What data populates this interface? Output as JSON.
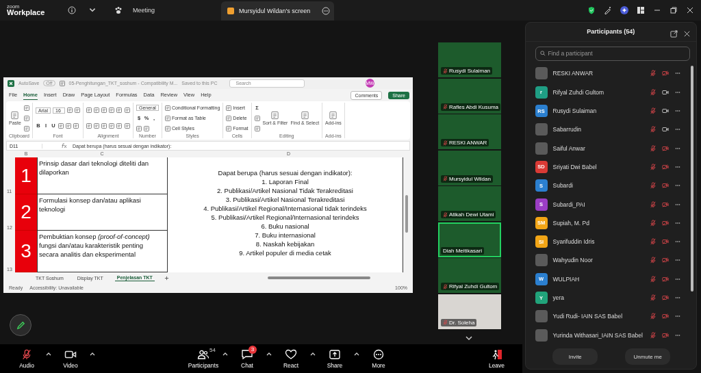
{
  "app_bar": {
    "logo_top": "zoom",
    "logo_bottom": "Workplace",
    "meeting_tab": "Meeting",
    "share_tab": "Mursyidul Wildan's screen"
  },
  "excel": {
    "title_bar": {
      "autosave": "AutoSave",
      "autosave_state": "Off",
      "filename": "05-Penghitungan_TKT_soshum - Compatibility M...",
      "saved": "Saved to this PC",
      "search": "Search",
      "user_initials": "MW"
    },
    "menu_tabs": [
      {
        "label": "File",
        "selected": false
      },
      {
        "label": "Home",
        "selected": true
      },
      {
        "label": "Insert",
        "selected": false
      },
      {
        "label": "Draw",
        "selected": false
      },
      {
        "label": "Page Layout",
        "selected": false
      },
      {
        "label": "Formulas",
        "selected": false
      },
      {
        "label": "Data",
        "selected": false
      },
      {
        "label": "Review",
        "selected": false
      },
      {
        "label": "View",
        "selected": false
      },
      {
        "label": "Help",
        "selected": false
      }
    ],
    "comments": "Comments",
    "share": "Share",
    "ribbon_groups": [
      {
        "label": "Clipboard",
        "parts": [
          {
            "kind": "big",
            "label": "Paste"
          },
          {
            "kind": "stack",
            "lines": [
              [
                {
                  "kind": "glyph"
                }
              ],
              [
                {
                  "kind": "glyph"
                }
              ],
              [
                {
                  "kind": "glyph"
                }
              ]
            ]
          }
        ]
      },
      {
        "label": "Font",
        "parts": [
          {
            "kind": "stack",
            "lines": [
              [
                {
                  "kind": "field",
                  "label": "Arial"
                },
                {
                  "kind": "field",
                  "label": "16"
                },
                {
                  "kind": "glyph"
                },
                {
                  "kind": "glyph"
                }
              ],
              [
                {
                  "kind": "toggle",
                  "label": "B"
                },
                {
                  "kind": "toggle",
                  "label": "I"
                },
                {
                  "kind": "toggle",
                  "label": "U"
                },
                {
                  "kind": "glyph"
                },
                {
                  "kind": "glyph"
                },
                {
                  "kind": "glyph"
                }
              ]
            ]
          }
        ]
      },
      {
        "label": "Alignment",
        "parts": [
          {
            "kind": "stack",
            "lines": [
              [
                {
                  "kind": "glyph"
                },
                {
                  "kind": "glyph"
                },
                {
                  "kind": "glyph"
                },
                {
                  "kind": "glyph"
                },
                {
                  "kind": "glyph"
                }
              ],
              [
                {
                  "kind": "glyph"
                },
                {
                  "kind": "glyph"
                },
                {
                  "kind": "glyph"
                },
                {
                  "kind": "glyph"
                },
                {
                  "kind": "glyph"
                }
              ]
            ]
          },
          {
            "kind": "stack",
            "lines": [
              [
                {
                  "kind": "glyph"
                }
              ],
              [
                {
                  "kind": "glyph"
                }
              ]
            ]
          }
        ]
      },
      {
        "label": "Number",
        "parts": [
          {
            "kind": "stack",
            "lines": [
              [
                {
                  "kind": "field",
                  "label": "General"
                }
              ],
              [
                {
                  "kind": "symbol",
                  "label": "$"
                },
                {
                  "kind": "symbol",
                  "label": "%"
                },
                {
                  "kind": "symbol",
                  "label": ","
                }
              ],
              [
                {
                  "kind": "glyph"
                },
                {
                  "kind": "glyph"
                }
              ]
            ]
          }
        ]
      },
      {
        "label": "Styles",
        "parts": [
          {
            "kind": "stack",
            "lines": [
              [
                {
                  "kind": "menu",
                  "label": "Conditional Formatting"
                }
              ],
              [
                {
                  "kind": "menu",
                  "label": "Format as Table"
                }
              ],
              [
                {
                  "kind": "menu",
                  "label": "Cell Styles"
                }
              ]
            ]
          }
        ]
      },
      {
        "label": "Cells",
        "parts": [
          {
            "kind": "stack",
            "lines": [
              [
                {
                  "kind": "menu",
                  "label": "Insert"
                }
              ],
              [
                {
                  "kind": "menu",
                  "label": "Delete"
                }
              ],
              [
                {
                  "kind": "menu",
                  "label": "Format"
                }
              ]
            ]
          }
        ]
      },
      {
        "label": "Editing",
        "parts": [
          {
            "kind": "stack",
            "lines": [
              [
                {
                  "kind": "symbol",
                  "label": "Σ"
                }
              ],
              [
                {
                  "kind": "glyph"
                }
              ],
              [
                {
                  "kind": "glyph"
                }
              ]
            ]
          },
          {
            "kind": "big",
            "label": "Sort & Filter"
          },
          {
            "kind": "big",
            "label": "Find & Select"
          }
        ]
      },
      {
        "label": "Add-ins",
        "parts": [
          {
            "kind": "big",
            "label": "Add-ins"
          }
        ]
      }
    ],
    "name_box": "D11",
    "formula": "Dapat berupa (harus sesuai dengan indikator):",
    "columns": [
      "B",
      "C",
      "D"
    ],
    "rows": [
      {
        "number": "11",
        "level": "1",
        "description": "Prinsip dasar dari teknologi diteliti dan dilaporkan"
      },
      {
        "number": "12",
        "level": "2",
        "description": "Formulasi konsep dan/atau aplikasi teknologi"
      },
      {
        "number": "13",
        "level": "3",
        "description": "Pembuktian konsep *(proof-of-concept)* fungsi dan/atau karakteristik penting secara analitis dan eksperimental"
      }
    ],
    "output_heading": "Dapat berupa (harus sesuai dengan indikator):",
    "output_lines": [
      "1. Laporan Final",
      "2. Publikasi/Artikel Nasional Tidak Terakreditasi",
      "3. Publikasi/Artikel Nasional Terakreditasi",
      "4. Publikasi/Artikel Regional/Internasional tidak terindeks",
      "5. Publikasi/Artikel Regional/Internasional terindeks",
      "6. Buku nasional",
      "7. Buku internasional",
      "8. Naskah kebijakan",
      "9. Artikel populer di media cetak"
    ],
    "sheet_tabs": [
      {
        "label": "TKT Soshum",
        "selected": false
      },
      {
        "label": "Display TKT",
        "selected": false
      },
      {
        "label": "Penjelasan TKT",
        "selected": true
      }
    ],
    "status": "Ready",
    "accessibility": "Accessibility: Unavailable",
    "zoom": "100%"
  },
  "video_tiles": [
    {
      "name": "Rusydi Sulaiman",
      "kind": "slide",
      "active": false,
      "mic_muted": true
    },
    {
      "name": "Rafles Abdi Kusuma",
      "kind": "slide",
      "active": false,
      "mic_muted": true
    },
    {
      "name": "RESKI ANWAR",
      "kind": "slide",
      "active": false,
      "mic_muted": true
    },
    {
      "name": "Mursyidul Wildan",
      "kind": "slide",
      "active": false,
      "mic_muted": true
    },
    {
      "name": "Atikah Dewi Utami",
      "kind": "slide",
      "active": false,
      "mic_muted": true
    },
    {
      "name": "Diah Meitikasari",
      "kind": "slide",
      "active": true,
      "mic_muted": false
    },
    {
      "name": "Rifyal Zuhdi Gultom",
      "kind": "slide",
      "active": false,
      "mic_muted": true
    },
    {
      "name": "Dr. Soleha",
      "kind": "camera",
      "active": false,
      "mic_muted": true
    }
  ],
  "participants_panel": {
    "title": "Participants (54)",
    "search_placeholder": "Find a participant",
    "participants": [
      {
        "name": "RESKI ANWAR",
        "avatar": {
          "kind": "photo"
        },
        "mic_muted": true,
        "video_on": false
      },
      {
        "name": "Rifyal Zuhdi Gultom",
        "avatar": {
          "kind": "initials",
          "initials": "r",
          "color": "#1f9e84"
        },
        "mic_muted": true,
        "video_on": true
      },
      {
        "name": "Rusydi Sulaiman",
        "avatar": {
          "kind": "initials",
          "initials": "RS",
          "color": "#2b7fcf"
        },
        "mic_muted": true,
        "video_on": true
      },
      {
        "name": "Sabarrudin",
        "avatar": {
          "kind": "photo"
        },
        "mic_muted": true,
        "video_on": true
      },
      {
        "name": "Saiful Anwar",
        "avatar": {
          "kind": "photo"
        },
        "mic_muted": true,
        "video_on": false
      },
      {
        "name": "Sriyati Dwi Babel",
        "avatar": {
          "kind": "initials",
          "initials": "SD",
          "color": "#d93a35"
        },
        "mic_muted": true,
        "video_on": false
      },
      {
        "name": "Subardi",
        "avatar": {
          "kind": "initials",
          "initials": "S",
          "color": "#2b7fcf"
        },
        "mic_muted": true,
        "video_on": false
      },
      {
        "name": "Subardi_PAI",
        "avatar": {
          "kind": "initials",
          "initials": "S",
          "color": "#9b3dc4"
        },
        "mic_muted": true,
        "video_on": false
      },
      {
        "name": "Supiah, M. Pd",
        "avatar": {
          "kind": "initials",
          "initials": "SM",
          "color": "#f2a516"
        },
        "mic_muted": true,
        "video_on": false
      },
      {
        "name": "Syarifuddin Idris",
        "avatar": {
          "kind": "initials",
          "initials": "SI",
          "color": "#f2a516"
        },
        "mic_muted": true,
        "video_on": false
      },
      {
        "name": "Wahyudin Noor",
        "avatar": {
          "kind": "photo"
        },
        "mic_muted": true,
        "video_on": false
      },
      {
        "name": "WULPIAH",
        "avatar": {
          "kind": "initials",
          "initials": "W",
          "color": "#2b7fcf"
        },
        "mic_muted": true,
        "video_on": false
      },
      {
        "name": "yera",
        "avatar": {
          "kind": "initials",
          "initials": "Y",
          "color": "#21a37a"
        },
        "mic_muted": true,
        "video_on": false
      },
      {
        "name": "Yudi Rudi- IAIN SAS Babel",
        "avatar": {
          "kind": "photo"
        },
        "mic_muted": true,
        "video_on": false
      },
      {
        "name": "Yurinda Withasari_IAIN SAS Babel",
        "avatar": {
          "kind": "photo"
        },
        "mic_muted": true,
        "video_on": false
      }
    ],
    "buttons": [
      "Invite",
      "Unmute me"
    ]
  },
  "toolbar": {
    "audio": {
      "label": "Audio",
      "muted": true
    },
    "video": {
      "label": "Video",
      "off": false
    },
    "center_items": [
      {
        "kind": "participants",
        "label": "Participants",
        "count": "54",
        "caret": true
      },
      {
        "kind": "chat",
        "label": "Chat",
        "badge": "3",
        "caret": true
      },
      {
        "kind": "react",
        "label": "React",
        "caret": true
      },
      {
        "kind": "share",
        "label": "Share",
        "caret": true
      },
      {
        "kind": "more",
        "label": "More",
        "caret": false
      }
    ],
    "leave": {
      "label": "Leave"
    }
  }
}
